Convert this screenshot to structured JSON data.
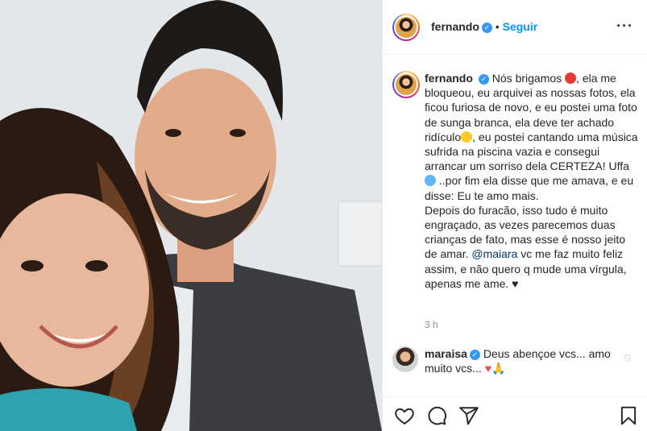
{
  "post": {
    "username": "fernando",
    "verified_mark": "✓",
    "dot": "•",
    "follow_label": "Seguir",
    "more_icon": "more-options-icon",
    "more_glyph": "···"
  },
  "caption": {
    "username": "fernando",
    "line1": "Nós brigamos ",
    "line2": ", ela me bloqueou, eu arquivei as nossas fotos, ela ficou furiosa de novo, e eu postei uma foto de sunga branca, ela deve ter achado ridículo",
    "line3": ", eu postei cantando uma música sufrida na piscina vazia e consegui arrancar um sorriso dela CERTEZA! Uffa ",
    "line4": " ..por fim ela disse que me amava, e eu disse: Eu te amo mais.",
    "line5": "Depois do furacão, isso tudo é muito engraçado, as vezes parecemos duas crianças de fato, mas esse é nosso jeito de amar. ",
    "mention": "@maiara",
    "line6": " vc me faz muito feliz assim, e não quero q mude uma vírgula, apenas me ame. ",
    "heart": "♥",
    "timestamp": "3 h"
  },
  "comment": {
    "username": "maraisa",
    "text": "Deus abençoe vcs... amo muito vcs... ",
    "heart": "♥",
    "pray": "🙏",
    "like_glyph": "♡"
  },
  "icons": {
    "like": "heart-outline-icon",
    "comment": "comment-icon",
    "share": "share-icon",
    "save": "bookmark-icon"
  },
  "colors": {
    "link": "#0095f6",
    "mention": "#00376b",
    "verified": "#3897f0",
    "muted": "#8e8e8e"
  }
}
